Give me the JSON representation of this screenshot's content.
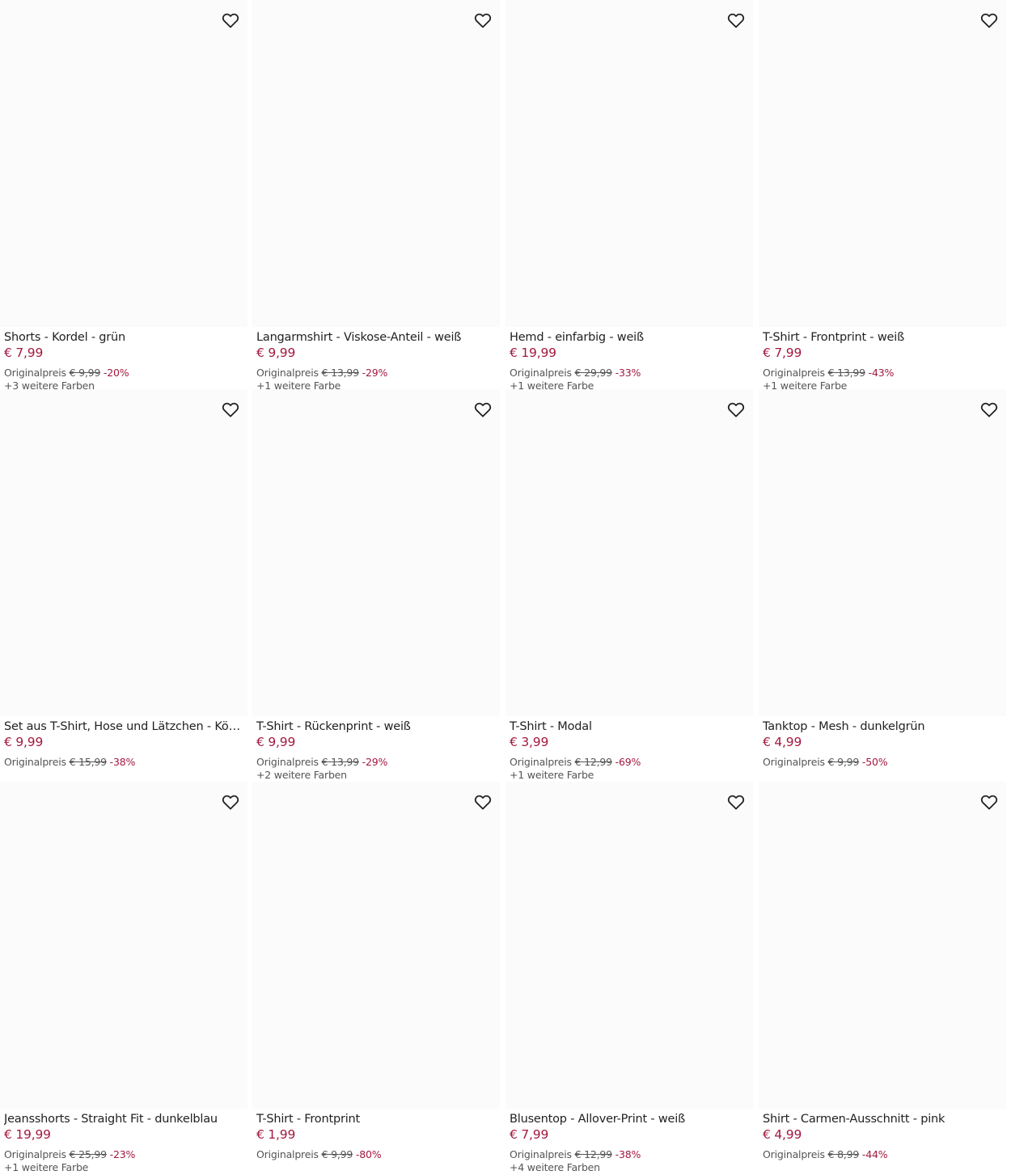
{
  "colors": {
    "accent": "#a3193f",
    "heart_stroke": "#222222"
  },
  "original_price_label": "Originalpreis",
  "products": [
    {
      "name": "Shorts - Kordel - grün",
      "price": "€ 7,99",
      "orig": "€ 9,99",
      "disc": "-20%",
      "colors": "+3 weitere Farben"
    },
    {
      "name": "Langarmshirt - Viskose-Anteil - weiß",
      "price": "€ 9,99",
      "orig": "€ 13,99",
      "disc": "-29%",
      "colors": "+1 weitere Farbe"
    },
    {
      "name": "Hemd - einfarbig - weiß",
      "price": "€ 19,99",
      "orig": "€ 29,99",
      "disc": "-33%",
      "colors": "+1 weitere Farbe"
    },
    {
      "name": "T-Shirt - Frontprint - weiß",
      "price": "€ 7,99",
      "orig": "€ 13,99",
      "disc": "-43%",
      "colors": "+1 weitere Farbe"
    },
    {
      "name": "Set aus T-Shirt, Hose und Lätzchen - König ...",
      "price": "€ 9,99",
      "orig": "€ 15,99",
      "disc": "-38%",
      "colors": ""
    },
    {
      "name": "T-Shirt - Rückenprint - weiß",
      "price": "€ 9,99",
      "orig": "€ 13,99",
      "disc": "-29%",
      "colors": "+2 weitere Farben"
    },
    {
      "name": "T-Shirt - Modal",
      "price": "€ 3,99",
      "orig": "€ 12,99",
      "disc": "-69%",
      "colors": "+1 weitere Farbe"
    },
    {
      "name": "Tanktop - Mesh - dunkelgrün",
      "price": "€ 4,99",
      "orig": "€ 9,99",
      "disc": "-50%",
      "colors": ""
    },
    {
      "name": "Jeansshorts - Straight Fit - dunkelblau",
      "price": "€ 19,99",
      "orig": "€ 25,99",
      "disc": "-23%",
      "colors": "+1 weitere Farbe"
    },
    {
      "name": "T-Shirt - Frontprint",
      "price": "€ 1,99",
      "orig": "€ 9,99",
      "disc": "-80%",
      "colors": ""
    },
    {
      "name": "Blusentop - Allover-Print - weiß",
      "price": "€ 7,99",
      "orig": "€ 12,99",
      "disc": "-38%",
      "colors": "+4 weitere Farben"
    },
    {
      "name": "Shirt - Carmen-Ausschnitt - pink",
      "price": "€ 4,99",
      "orig": "€ 8,99",
      "disc": "-44%",
      "colors": ""
    }
  ]
}
